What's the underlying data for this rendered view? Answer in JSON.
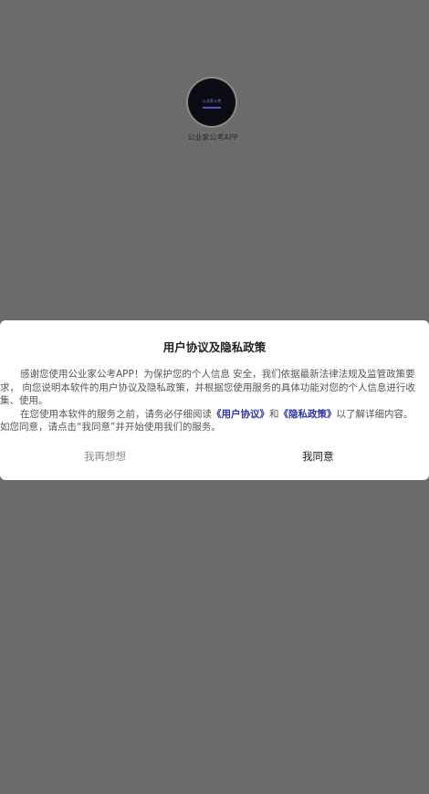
{
  "splash": {
    "logo_text": "公业家公考",
    "app_name": "公业家公考APP"
  },
  "dialog": {
    "title": "用户协议及隐私政策",
    "para1": "感谢您使用公业家公考APP！为保护您的个人信息 安全，我们依据最新法律法规及监管政策要求， 向您说明本软件的用户协议及隐私政策，并根据您使用服务的具体功能对您的个人信息进行收集、使用。",
    "para2_before": "在您使用本软件的服务之前，请务必仔细阅读",
    "link_user_agreement": "《用户协议》",
    "para2_and": "和",
    "link_privacy_policy": "《隐私政策》",
    "para2_after": "以了解详细内容。 如您同意，请点击“我同意”并开始使用我们的服务。",
    "reject_label": "我再想想",
    "accept_label": "我同意"
  }
}
